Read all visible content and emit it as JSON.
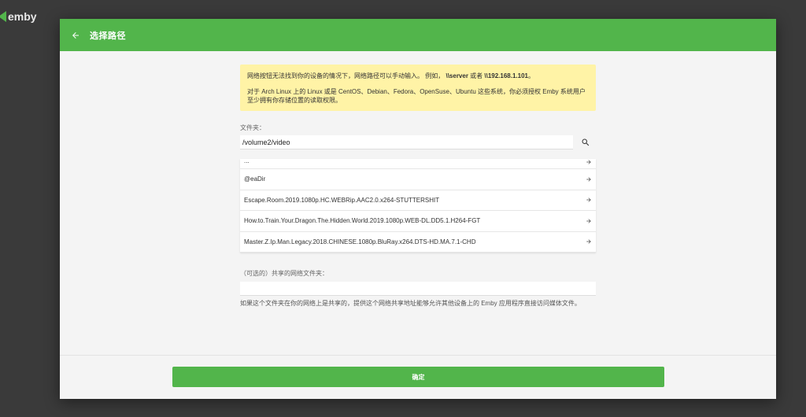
{
  "brand": {
    "name": "emby"
  },
  "dialog": {
    "title": "选择路径",
    "notice": {
      "line1_prefix": "网络按钮无法找到你的设备的情况下，网络路径可以手动输入。 例如，",
      "line1_example1": "\\\\server",
      "line1_or": " 或者 ",
      "line1_example2": "\\\\192.168.1.101",
      "line1_suffix": "。",
      "line2": "对于 Arch Linux 上的 Linux 或是 CentOS、Debian、Fedora、OpenSuse、Ubuntu 这些系统，你必须授权 Emby 系统用户至少拥有你存储位置的读取权限。"
    },
    "folder": {
      "label": "文件夹：",
      "value": "/volume2/video"
    },
    "directories": [
      {
        "name": "..."
      },
      {
        "name": "@eaDir"
      },
      {
        "name": "Escape.Room.2019.1080p.HC.WEBRip.AAC2.0.x264-STUTTERSHIT"
      },
      {
        "name": "How.to.Train.Your.Dragon.The.Hidden.World.2019.1080p.WEB-DL.DD5.1.H264-FGT"
      },
      {
        "name": "Master.Z.Ip.Man.Legacy.2018.CHINESE.1080p.BluRay.x264.DTS-HD.MA.7.1-CHD"
      }
    ],
    "share": {
      "label": "（可选的）共享的网络文件夹：",
      "value": "",
      "help": "如果这个文件夹在你的网络上是共享的，提供这个网络共享地址能够允许其他设备上的 Emby 应用程序直接访问媒体文件。"
    },
    "confirm_label": "确定"
  },
  "icons": {
    "back": "arrow-left-icon",
    "search": "search-icon",
    "chevron": "arrow-right-icon"
  },
  "colors": {
    "accent": "#52b54b",
    "notice_bg": "#fff3a6",
    "backdrop": "#3a3a3a"
  }
}
